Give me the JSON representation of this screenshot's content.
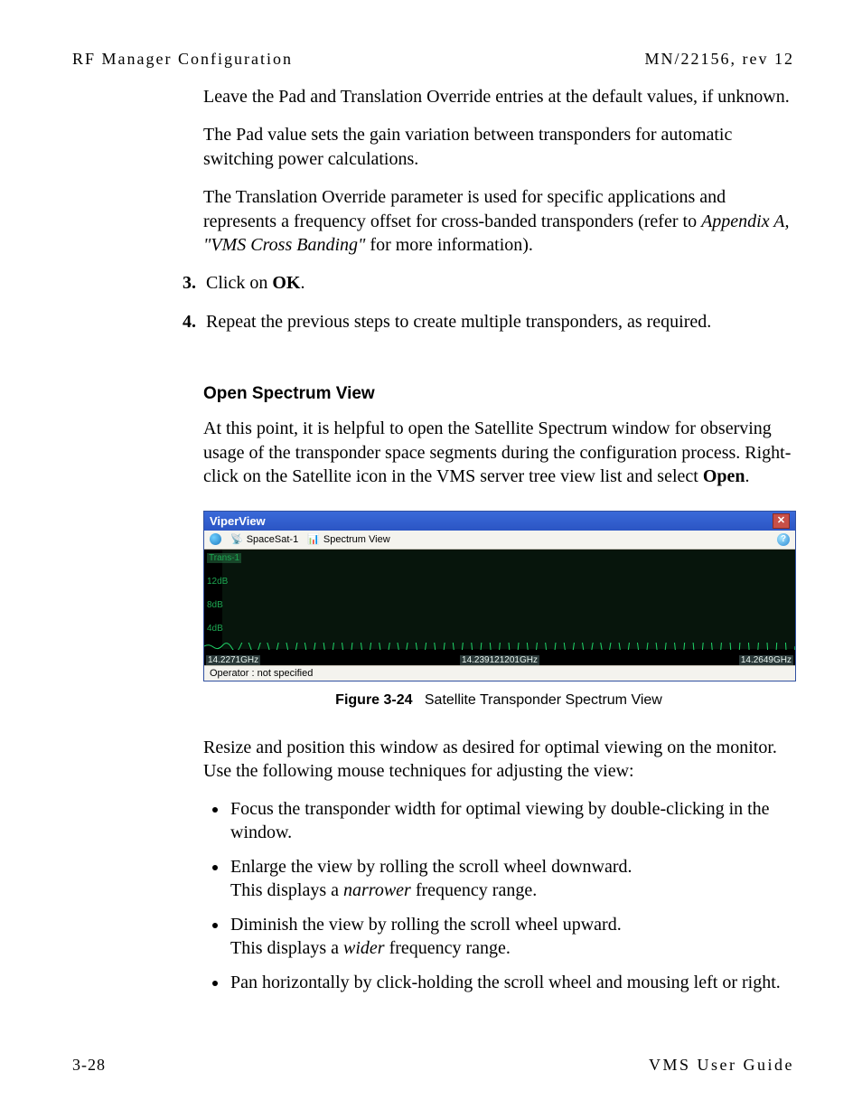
{
  "header": {
    "left": "RF Manager Configuration",
    "right": "MN/22156, rev 12"
  },
  "para1": "Leave the Pad and Translation Override entries at the default values, if unknown.",
  "para2": "The Pad value sets the gain variation between transponders for automatic switching power calculations.",
  "para3_lead": "The Translation Override parameter is used for specific applications and represents a frequency offset for cross-banded transponders (refer to ",
  "para3_italic": "Appendix A, \"VMS Cross Banding\"",
  "para3_tail": " for more information).",
  "step3_num": "3.",
  "step3_a": "Click on ",
  "step3_b": "OK",
  "step3_c": ".",
  "step4_num": "4.",
  "step4": "Repeat the previous steps to create multiple transponders, as required.",
  "section_heading": "Open Spectrum View",
  "section_para_a": "At this point, it is helpful to open the Satellite Spectrum window for observing usage of the transponder space segments during the configuration process. Right-click on the Satellite icon in the VMS server tree view list and select ",
  "section_para_b": "Open",
  "section_para_c": ".",
  "viper": {
    "title": "ViperView",
    "sat_label": "SpaceSat-1",
    "view_label": "Spectrum View",
    "help": "?",
    "close": "✕",
    "y_trans1": "Trans-1",
    "y_12db": "12dB",
    "y_8db": "8dB",
    "y_4db": "4dB",
    "freq_left": "14.2271GHz",
    "freq_mid": "14.239121201GHz",
    "freq_right": "14.2649GHz",
    "status": "Operator : not specified"
  },
  "figcap_lead": "Figure 3-24",
  "figcap_text": "Satellite Transponder Spectrum View",
  "resize_para": "Resize and position this window as desired for optimal viewing on the monitor. Use the following mouse techniques for adjusting the view:",
  "b1": "Focus the transponder width for optimal viewing by double-clicking in the window.",
  "b2a": "Enlarge the view by rolling the scroll wheel downward.",
  "b2b": "This displays a ",
  "b2c": "narrower",
  "b2d": " frequency range.",
  "b3a": "Diminish the view by rolling the scroll wheel upward.",
  "b3b": "This displays a ",
  "b3c": "wider",
  "b3d": " frequency range.",
  "b4": "Pan horizontally by click-holding the scroll wheel and mousing left or right.",
  "footer": {
    "left": "3-28",
    "right": "VMS User Guide"
  }
}
